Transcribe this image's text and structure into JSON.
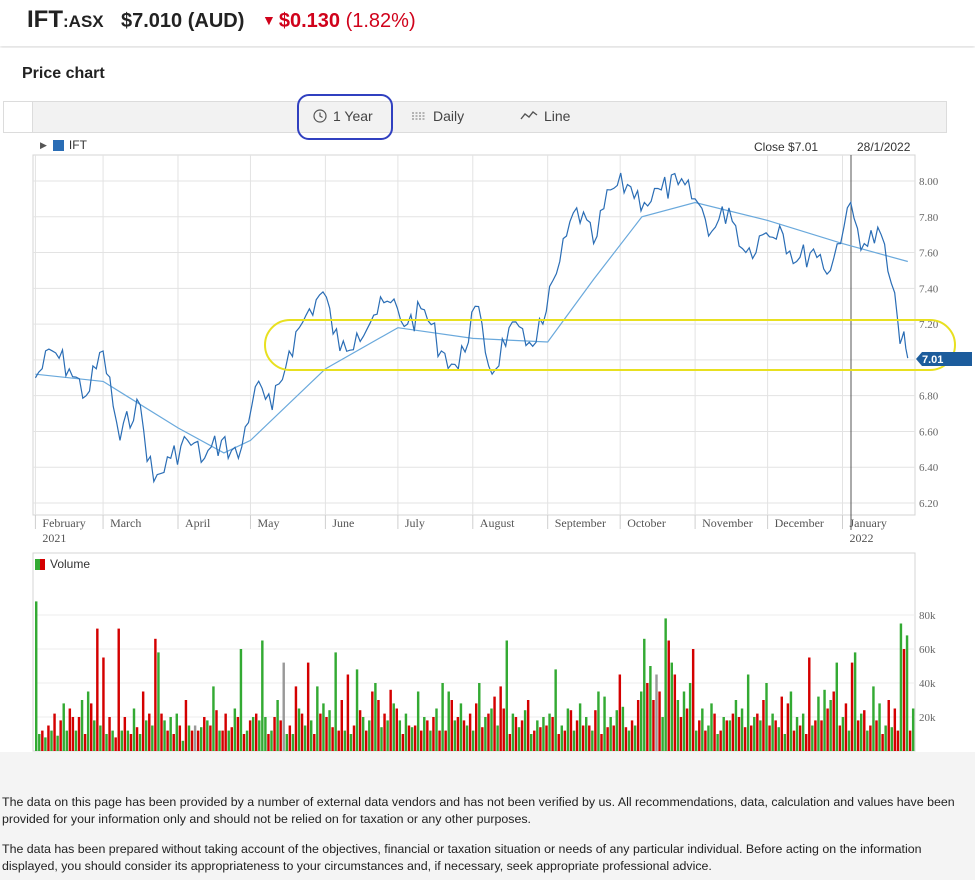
{
  "header": {
    "symbol": "IFT",
    "exchange": ":ASX",
    "price": "$7.010 (AUD)",
    "change_amount": "$0.130",
    "change_percent": "(1.82%)",
    "change_color": "#d0021b"
  },
  "card": {
    "title": "Price chart"
  },
  "toolbar": {
    "period_label": "1 Year",
    "interval_label": "Daily",
    "type_label": "Line",
    "period_icon": "clock-icon",
    "interval_icon": "candles-icon",
    "type_icon": "line-chart-icon"
  },
  "chart_header": {
    "series_label": "IFT",
    "close_label": "Close $7.01",
    "date_label": "28/1/2022",
    "last_marker": "7.01"
  },
  "volume_legend": {
    "label": "Volume"
  },
  "chart_data": [
    {
      "type": "line",
      "series": [
        {
          "name": "IFT",
          "color": "#2a6db5",
          "x": [
            "2021-02-01",
            "2021-02-08",
            "2021-02-15",
            "2021-02-22",
            "2021-03-01",
            "2021-03-08",
            "2021-03-15",
            "2021-03-22",
            "2021-03-29",
            "2021-04-05",
            "2021-04-12",
            "2021-04-19",
            "2021-04-26",
            "2021-05-03",
            "2021-05-10",
            "2021-05-17",
            "2021-05-24",
            "2021-05-31",
            "2021-06-07",
            "2021-06-14",
            "2021-06-21",
            "2021-06-28",
            "2021-07-05",
            "2021-07-12",
            "2021-07-19",
            "2021-07-26",
            "2021-08-02",
            "2021-08-09",
            "2021-08-16",
            "2021-08-23",
            "2021-08-30",
            "2021-09-06",
            "2021-09-13",
            "2021-09-20",
            "2021-09-27",
            "2021-10-04",
            "2021-10-11",
            "2021-10-18",
            "2021-10-25",
            "2021-11-01",
            "2021-11-08",
            "2021-11-15",
            "2021-11-22",
            "2021-11-29",
            "2021-12-06",
            "2021-12-13",
            "2021-12-20",
            "2021-12-27",
            "2022-01-03",
            "2022-01-10",
            "2022-01-17",
            "2022-01-24",
            "2022-01-28"
          ],
          "y": [
            6.9,
            7.05,
            6.95,
            6.8,
            7.05,
            6.55,
            6.78,
            6.32,
            6.45,
            6.55,
            6.45,
            6.55,
            6.45,
            6.85,
            6.72,
            7.05,
            7.25,
            7.38,
            7.05,
            7.15,
            7.25,
            7.32,
            7.2,
            7.28,
            7.05,
            6.95,
            7.3,
            6.92,
            7.18,
            7.08,
            7.2,
            7.55,
            7.85,
            7.65,
            7.95,
            7.98,
            7.88,
            7.95,
            7.98,
            7.9,
            7.72,
            7.85,
            7.6,
            7.7,
            7.75,
            7.55,
            7.62,
            7.5,
            7.85,
            7.65,
            7.7,
            7.2,
            7.01
          ]
        },
        {
          "name": "Moving average",
          "color": "#6aa9dc",
          "x": [
            "2021-02-01",
            "2021-03-01",
            "2021-04-01",
            "2021-04-20",
            "2021-05-01",
            "2021-06-01",
            "2021-07-01",
            "2021-08-01",
            "2021-09-01",
            "2021-09-20",
            "2021-10-10",
            "2021-11-01",
            "2021-12-01",
            "2022-01-01",
            "2022-01-28"
          ],
          "y": [
            6.92,
            6.88,
            6.62,
            6.48,
            6.55,
            6.95,
            7.18,
            7.12,
            7.1,
            7.45,
            7.8,
            7.88,
            7.78,
            7.65,
            7.55
          ]
        }
      ],
      "x_tick_labels": [
        [
          "February",
          "2021"
        ],
        [
          "March"
        ],
        [
          "April"
        ],
        [
          "May"
        ],
        [
          "June"
        ],
        [
          "July"
        ],
        [
          "August"
        ],
        [
          "September"
        ],
        [
          "October"
        ],
        [
          "November"
        ],
        [
          "December"
        ],
        [
          "January",
          "2022"
        ]
      ],
      "y_ticks": [
        "8.00",
        "7.80",
        "7.60",
        "7.40",
        "7.20",
        "7.00",
        "6.80",
        "6.60",
        "6.40",
        "6.20"
      ],
      "ylim": [
        6.2,
        8.0
      ]
    },
    {
      "type": "bar",
      "title": "Volume",
      "y_ticks": [
        "80k",
        "60k",
        "40k",
        "20k"
      ],
      "ylim": [
        0,
        80000
      ],
      "up_color": "#33aa33",
      "down_color": "#d40000",
      "flat_color": "#999999",
      "values": [
        88,
        10,
        12,
        8,
        15,
        12,
        22,
        9,
        18,
        28,
        12,
        25,
        20,
        12,
        20,
        30,
        10,
        35,
        28,
        18,
        72,
        15,
        55,
        10,
        20,
        12,
        8,
        72,
        12,
        20,
        12,
        10,
        25,
        14,
        10,
        35,
        18,
        22,
        15,
        66,
        58,
        22,
        18,
        12,
        20,
        10,
        22,
        15,
        6,
        30,
        15,
        12,
        15,
        12,
        14,
        20,
        18,
        15,
        38,
        24,
        12,
        12,
        22,
        12,
        14,
        25,
        20,
        60,
        10,
        12,
        18,
        20,
        22,
        18,
        65,
        20,
        10,
        12,
        20,
        30,
        18,
        52,
        10,
        15,
        10,
        38,
        25,
        22,
        15,
        52,
        18,
        10,
        38,
        22,
        28,
        20,
        24,
        14,
        58,
        12,
        30,
        12,
        45,
        10,
        15,
        48,
        24,
        20,
        12,
        18,
        35,
        40,
        30,
        14,
        22,
        18,
        36,
        28,
        25,
        18,
        10,
        22,
        15,
        14,
        15,
        35,
        12,
        20,
        18,
        12,
        20,
        25,
        12,
        40,
        12,
        35,
        30,
        18,
        20,
        28,
        18,
        15,
        22,
        12,
        28,
        40,
        14,
        20,
        22,
        25,
        32,
        15,
        38,
        25,
        65,
        10,
        22,
        20,
        14,
        18,
        24,
        30,
        10,
        12,
        18,
        14,
        20,
        15,
        22,
        20,
        48,
        10,
        15,
        12,
        25,
        24,
        12,
        18,
        28,
        15,
        20,
        15,
        12,
        24,
        35,
        10,
        32,
        14,
        20,
        15,
        24,
        45,
        26,
        14,
        12,
        18,
        15,
        30,
        35,
        66,
        40,
        50,
        30,
        45,
        35,
        20,
        78,
        65,
        52,
        45,
        30,
        20,
        35,
        25,
        40,
        60,
        12,
        18,
        25,
        12,
        15,
        28,
        22,
        10,
        12,
        20,
        18,
        18,
        22,
        30,
        20,
        25,
        14,
        45,
        15,
        20,
        22,
        18,
        30,
        40,
        15,
        22,
        18,
        14,
        32,
        10,
        28,
        35,
        12,
        20,
        15,
        22,
        10,
        55,
        15,
        18,
        32,
        18,
        36,
        25,
        30,
        35,
        52,
        15,
        20,
        28,
        12,
        52,
        58,
        18,
        22,
        24,
        12,
        15,
        38,
        18,
        28,
        10,
        15,
        30,
        14,
        25,
        12,
        75,
        60,
        68,
        12,
        25
      ],
      "colors": [
        "g",
        "g",
        "r",
        "g",
        "r",
        "g",
        "r",
        "g",
        "r",
        "g",
        "g",
        "r",
        "r",
        "g",
        "r",
        "g",
        "r",
        "g",
        "r",
        "g",
        "r",
        "g",
        "r",
        "g",
        "r",
        "g",
        "r",
        "r",
        "g",
        "r",
        "g",
        "r",
        "g",
        "r",
        "g",
        "r",
        "g",
        "r",
        "g",
        "r",
        "g",
        "r",
        "g",
        "r",
        "g",
        "r",
        "g",
        "r",
        "g",
        "r",
        "g",
        "r",
        "f",
        "r",
        "g",
        "r",
        "g",
        "r",
        "g",
        "r",
        "g",
        "r",
        "r",
        "g",
        "r",
        "g",
        "r",
        "g",
        "r",
        "g",
        "r",
        "g",
        "r",
        "g",
        "g",
        "g",
        "r",
        "g",
        "r",
        "g",
        "r",
        "f",
        "g",
        "r",
        "g",
        "r",
        "g",
        "r",
        "g",
        "r",
        "g",
        "r",
        "g",
        "r",
        "g",
        "r",
        "g",
        "r",
        "g",
        "r",
        "r",
        "g",
        "r",
        "g",
        "r",
        "g",
        "r",
        "g",
        "r",
        "g",
        "r",
        "g",
        "r",
        "g",
        "r",
        "g",
        "r",
        "g",
        "r",
        "g",
        "r",
        "g",
        "r",
        "g",
        "r",
        "g",
        "r",
        "g",
        "r",
        "g",
        "r",
        "g",
        "r",
        "g",
        "r",
        "g",
        "r",
        "g",
        "r",
        "g",
        "r",
        "g",
        "r",
        "g",
        "r",
        "g",
        "r",
        "g",
        "r",
        "g",
        "r",
        "g",
        "r",
        "r",
        "g",
        "r",
        "g",
        "r",
        "g",
        "r",
        "g",
        "r",
        "g",
        "r",
        "g",
        "r",
        "g",
        "r",
        "g",
        "r",
        "g",
        "r",
        "g",
        "r",
        "g",
        "r",
        "g",
        "r",
        "g",
        "r",
        "g",
        "r",
        "g",
        "r",
        "g",
        "r",
        "g",
        "r",
        "g",
        "r",
        "g",
        "r",
        "g",
        "r",
        "g",
        "r",
        "g",
        "r",
        "g",
        "g",
        "r",
        "g",
        "r",
        "f",
        "r",
        "g",
        "g",
        "r",
        "g",
        "r",
        "g",
        "r",
        "g",
        "r",
        "g",
        "r",
        "g",
        "r",
        "g",
        "r",
        "g",
        "g",
        "r",
        "g",
        "r",
        "g",
        "r",
        "g",
        "r",
        "g",
        "r",
        "g",
        "r",
        "g",
        "r",
        "g",
        "r",
        "g",
        "r",
        "g",
        "r",
        "g",
        "r",
        "g",
        "r",
        "g",
        "r",
        "g",
        "r",
        "g",
        "r",
        "g",
        "r",
        "r",
        "g",
        "r",
        "g",
        "r",
        "g",
        "r",
        "g",
        "r",
        "g",
        "r",
        "g",
        "r",
        "g",
        "r",
        "g",
        "r",
        "g",
        "r",
        "g",
        "r",
        "g",
        "r",
        "g",
        "r",
        "g",
        "r",
        "g",
        "r",
        "r",
        "g",
        "r",
        "g",
        "r",
        "g",
        "r",
        "r",
        "g",
        "r",
        "r",
        "g"
      ]
    }
  ],
  "disclaimer": {
    "p1": "The data on this page has been provided by a number of external data vendors and has not been verified by us. All recommendations, data, calculation and values have been provided for your information only and should not be relied on for taxation or any other purposes.",
    "p2": "The data has been prepared without taking account of the objectives, financial or taxation situation or needs of any particular individual. Before acting on the information displayed, you should consider its appropriateness to your circumstances and, if necessary, seek appropriate professional advice."
  }
}
